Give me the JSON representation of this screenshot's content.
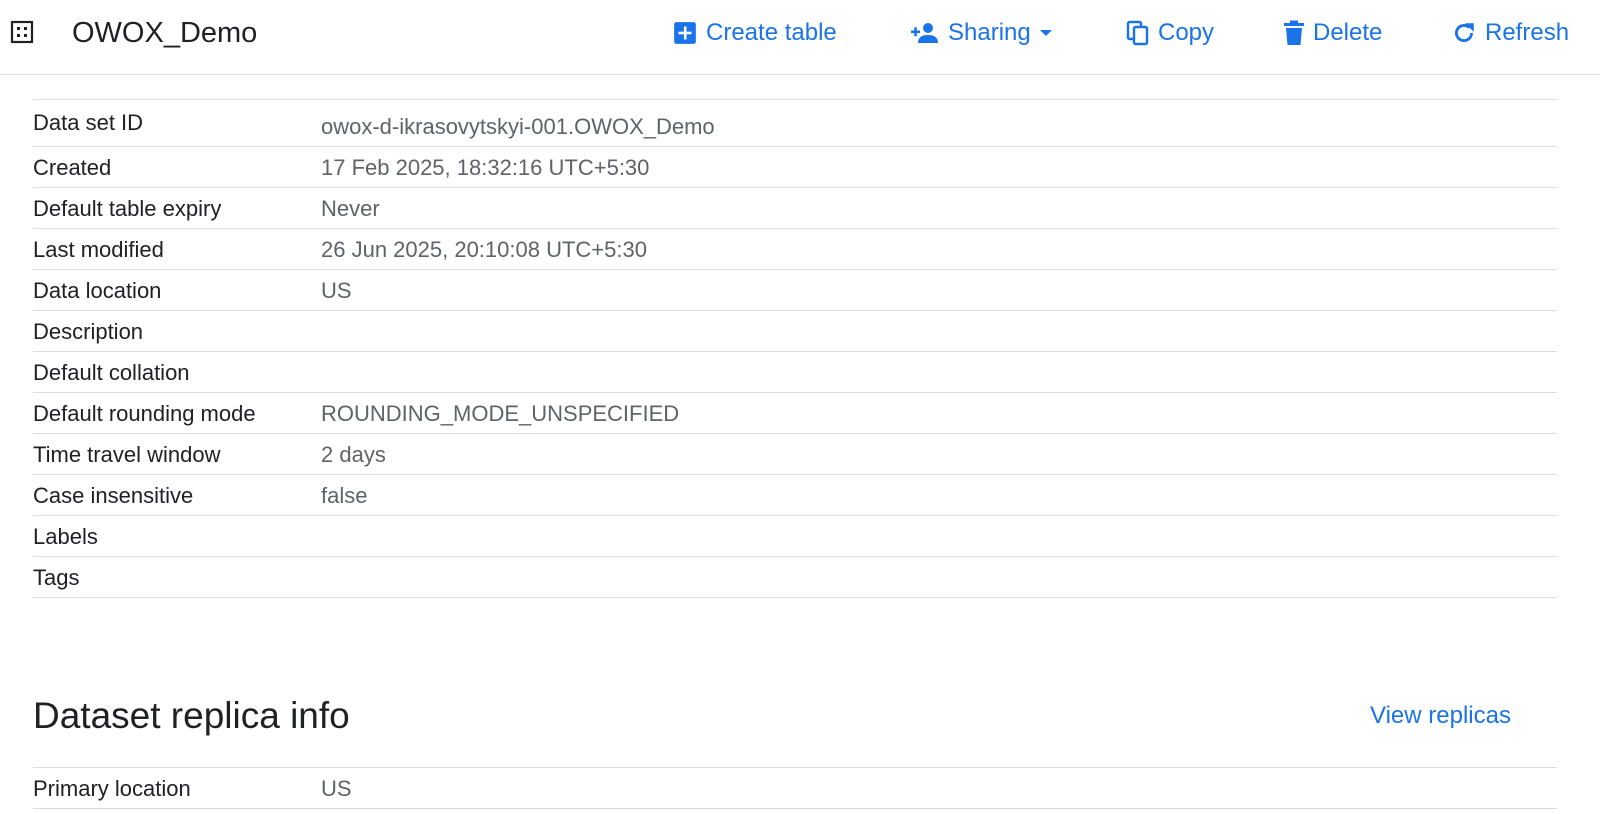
{
  "header": {
    "dataset_name": "OWOX_Demo",
    "icon": "dataset-grid-icon",
    "actions": {
      "create_table": "Create table",
      "sharing": "Sharing",
      "copy": "Copy",
      "delete": "Delete",
      "refresh": "Refresh"
    },
    "accent_color": "#1a73e8"
  },
  "details": [
    {
      "key": "Data set ID",
      "value": "owox-d-ikrasovytskyi-001.OWOX_Demo"
    },
    {
      "key": "Created",
      "value": "17 Feb 2025, 18:32:16 UTC+5:30"
    },
    {
      "key": "Default table expiry",
      "value": "Never"
    },
    {
      "key": "Last modified",
      "value": "26 Jun 2025, 20:10:08 UTC+5:30"
    },
    {
      "key": "Data location",
      "value": "US"
    },
    {
      "key": "Description",
      "value": ""
    },
    {
      "key": "Default collation",
      "value": ""
    },
    {
      "key": "Default rounding mode",
      "value": "ROUNDING_MODE_UNSPECIFIED"
    },
    {
      "key": "Time travel window",
      "value": "2 days"
    },
    {
      "key": "Case insensitive",
      "value": "false"
    },
    {
      "key": "Labels",
      "value": ""
    },
    {
      "key": "Tags",
      "value": ""
    }
  ],
  "replica_section": {
    "title": "Dataset replica info",
    "view_link": "View replicas",
    "rows": [
      {
        "key": "Primary location",
        "value": "US"
      }
    ]
  }
}
